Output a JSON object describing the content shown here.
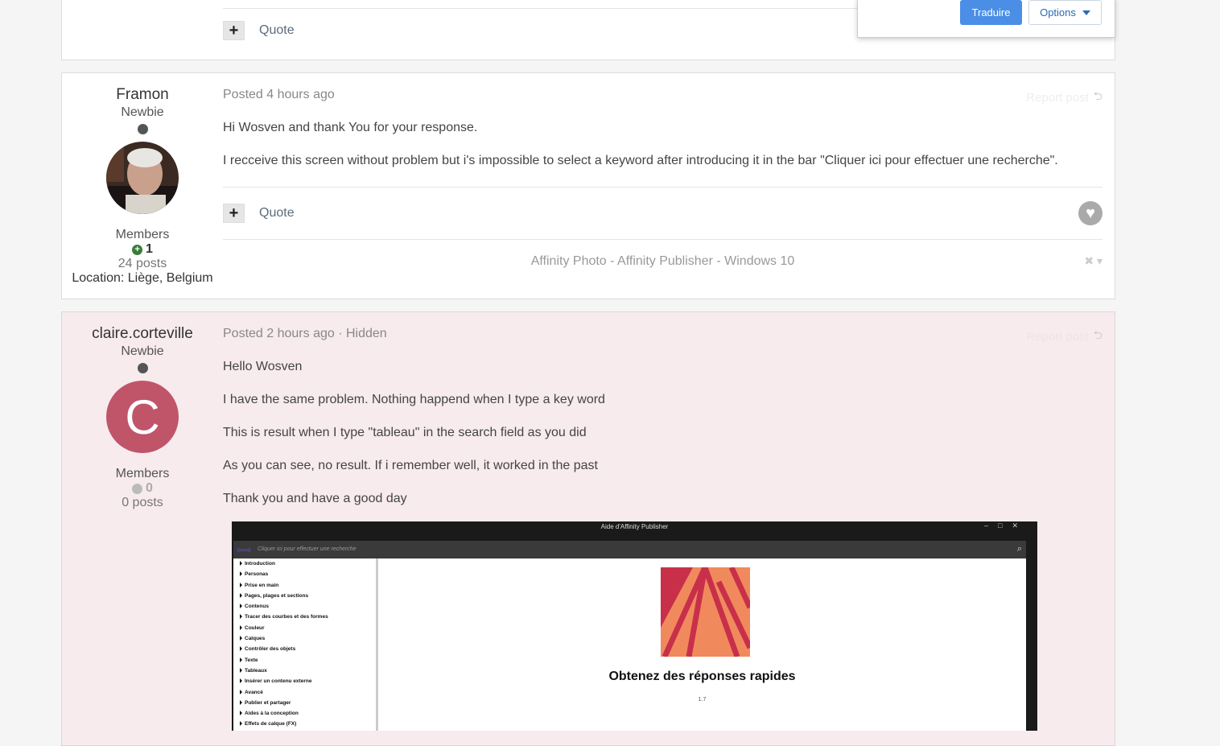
{
  "translate_popup": {
    "translate_label": "Traduire",
    "options_label": "Options"
  },
  "post0": {
    "quote_label": "Quote"
  },
  "post1": {
    "author": {
      "name": "Framon",
      "rank": "Newbie",
      "group": "Members",
      "reputation": "1",
      "posts": "24 posts",
      "location": "Location: Liège, Belgium"
    },
    "meta": "Posted 4 hours ago",
    "report_label": "Report post",
    "paragraphs": [
      "Hi Wosven and thank You for your response.",
      "I recceive this screen without problem but i's impossible to select a keyword after introducing  it in the bar \"Cliquer ici pour effectuer une recherche\"."
    ],
    "quote_label": "Quote",
    "signature": "Affinity Photo - Affinity Publisher - Windows 10"
  },
  "post2": {
    "author": {
      "name": "claire.corteville",
      "rank": "Newbie",
      "avatar_letter": "C",
      "group": "Members",
      "reputation": "0",
      "posts": "0 posts"
    },
    "meta": "Posted 2 hours ago · Hidden",
    "report_label": "Report post",
    "paragraphs": [
      "Hello Wosven",
      "I have the same problem. Nothing happend when I type a key word",
      "This is result when I type \"tableau\" in the search field as you did",
      "As you can see, no result. If i remember well, it worked in the past",
      "Thank you and have a good day"
    ],
    "screenshot": {
      "window_title": "Aide d'Affinity Publisher",
      "search_placeholder": "Cliquer ici pour effectuer une recherche",
      "toc": [
        "Introduction",
        "Personas",
        "Prise en main",
        "Pages, plages et sections",
        "Contenus",
        "Tracer des courbes et des formes",
        "Couleur",
        "Calques",
        "Contrôler des objets",
        "Texte",
        "Tableaux",
        "Insérer un contenu externe",
        "Avancé",
        "Publier et partager",
        "Aides à la conception",
        "Effets de calque (FX)"
      ],
      "heading": "Obtenez des réponses rapides",
      "version": "1.7"
    }
  }
}
